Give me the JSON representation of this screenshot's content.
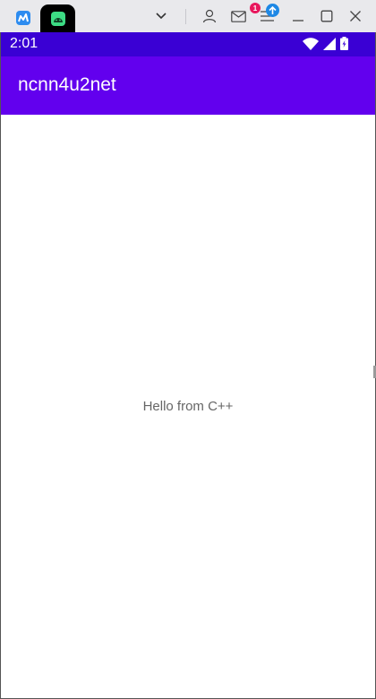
{
  "colors": {
    "status_bar": "#3a00d4",
    "app_bar": "#6200ee",
    "host_bar": "#e9e9ec",
    "badge_red": "#e8175d",
    "badge_blue": "#1e88e5",
    "tab_app_green": "#3ddc84",
    "tab_first_blue": "#2d8cf0"
  },
  "host": {
    "tabs": [
      {
        "name": "mirroring-app",
        "icon": "app-logo-icon"
      },
      {
        "name": "android-device",
        "icon": "android-icon"
      }
    ],
    "notification_count": "1",
    "icons": [
      "chevron-down-icon",
      "user-icon",
      "mail-icon",
      "menu-icon",
      "upload-icon",
      "minimize-icon",
      "maximize-icon",
      "close-icon"
    ]
  },
  "status": {
    "time": "2:01",
    "icons": [
      "wifi-icon",
      "signal-icon",
      "battery-icon"
    ]
  },
  "app": {
    "title": "ncnn4u2net",
    "message": "Hello from C++"
  }
}
